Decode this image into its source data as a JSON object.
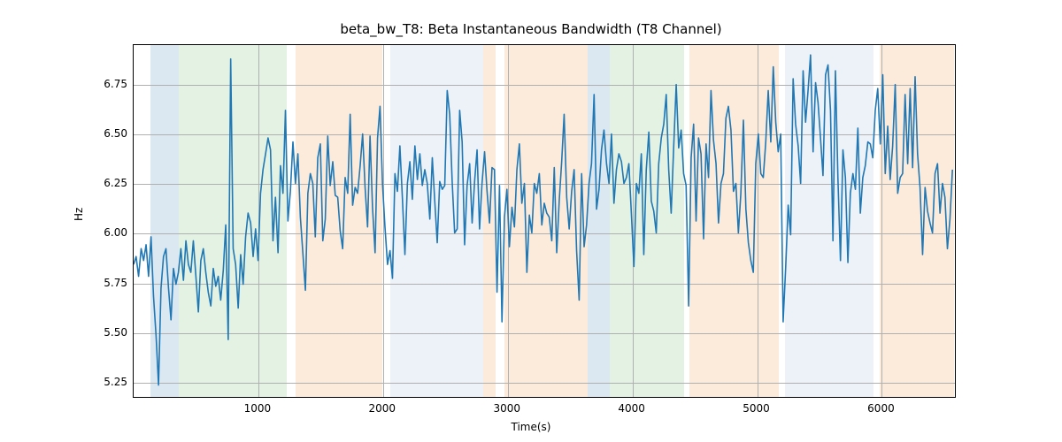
{
  "chart_data": {
    "type": "line",
    "title": "beta_bw_T8: Beta Instantaneous Bandwidth (T8 Channel)",
    "xlabel": "Time(s)",
    "ylabel": "Hz",
    "xlim": [
      0,
      6600
    ],
    "ylim": [
      5.17,
      6.95
    ],
    "x_ticks": [
      1000,
      2000,
      3000,
      4000,
      5000,
      6000
    ],
    "y_ticks": [
      5.25,
      5.5,
      5.75,
      6.0,
      6.25,
      6.5,
      6.75
    ],
    "x_tick_labels": [
      "1000",
      "2000",
      "3000",
      "4000",
      "5000",
      "6000"
    ],
    "y_tick_labels": [
      "5.25",
      "5.50",
      "5.75",
      "6.00",
      "6.25",
      "6.50",
      "6.75"
    ],
    "shaded_regions": [
      {
        "start": 135,
        "end": 365,
        "color": "blue"
      },
      {
        "start": 365,
        "end": 1230,
        "color": "green"
      },
      {
        "start": 1300,
        "end": 1995,
        "color": "orange"
      },
      {
        "start": 2060,
        "end": 2800,
        "color": "lblue"
      },
      {
        "start": 2800,
        "end": 2900,
        "color": "orange"
      },
      {
        "start": 2970,
        "end": 3640,
        "color": "orange"
      },
      {
        "start": 3640,
        "end": 3815,
        "color": "blue"
      },
      {
        "start": 3815,
        "end": 4415,
        "color": "green"
      },
      {
        "start": 4460,
        "end": 5175,
        "color": "orange"
      },
      {
        "start": 5225,
        "end": 5935,
        "color": "lblue"
      },
      {
        "start": 5980,
        "end": 6580,
        "color": "orange"
      }
    ],
    "values_sample_step": 20,
    "values": [
      5.84,
      5.88,
      5.78,
      5.92,
      5.86,
      5.94,
      5.78,
      5.98,
      5.68,
      5.48,
      5.23,
      5.72,
      5.88,
      5.92,
      5.72,
      5.56,
      5.82,
      5.74,
      5.8,
      5.92,
      5.76,
      5.96,
      5.84,
      5.8,
      5.96,
      5.78,
      5.6,
      5.86,
      5.92,
      5.8,
      5.7,
      5.63,
      5.82,
      5.73,
      5.78,
      5.66,
      5.81,
      6.04,
      5.46,
      6.88,
      5.92,
      5.84,
      5.62,
      5.89,
      5.74,
      5.98,
      6.1,
      6.05,
      5.88,
      6.02,
      5.86,
      6.2,
      6.32,
      6.4,
      6.48,
      6.42,
      5.96,
      6.18,
      5.9,
      6.34,
      6.2,
      6.62,
      6.06,
      6.21,
      6.46,
      6.25,
      6.4,
      6.08,
      5.9,
      5.71,
      6.2,
      6.3,
      6.25,
      5.98,
      6.38,
      6.45,
      5.96,
      6.07,
      6.49,
      6.24,
      6.36,
      6.19,
      6.18,
      6.01,
      5.92,
      6.28,
      6.2,
      6.6,
      6.14,
      6.23,
      6.2,
      6.34,
      6.5,
      6.23,
      6.03,
      6.49,
      6.13,
      5.9,
      6.48,
      6.64,
      6.25,
      6.03,
      5.84,
      5.91,
      5.77,
      6.3,
      6.21,
      6.44,
      6.17,
      5.89,
      6.25,
      6.36,
      6.17,
      6.44,
      6.27,
      6.4,
      6.24,
      6.32,
      6.25,
      6.07,
      6.38,
      6.16,
      5.95,
      6.26,
      6.22,
      6.24,
      6.72,
      6.6,
      6.26,
      6.0,
      6.02,
      6.62,
      6.46,
      5.94,
      6.24,
      6.35,
      6.05,
      6.26,
      6.42,
      6.02,
      6.25,
      6.41,
      6.21,
      6.05,
      6.33,
      6.32,
      5.7,
      6.24,
      5.55,
      6.08,
      6.22,
      5.93,
      6.13,
      6.03,
      6.32,
      6.45,
      6.15,
      6.25,
      5.8,
      6.09,
      6.0,
      6.25,
      6.2,
      6.3,
      6.04,
      6.15,
      6.1,
      6.08,
      5.96,
      6.33,
      5.9,
      6.16,
      6.36,
      6.6,
      6.18,
      6.02,
      6.21,
      6.32,
      5.91,
      5.66,
      6.3,
      5.93,
      6.04,
      6.25,
      6.35,
      6.7,
      6.12,
      6.22,
      6.42,
      6.52,
      6.35,
      6.25,
      6.5,
      6.15,
      6.32,
      6.4,
      6.36,
      6.25,
      6.28,
      6.35,
      6.1,
      5.83,
      6.25,
      6.2,
      6.4,
      5.89,
      6.32,
      6.51,
      6.16,
      6.11,
      6.0,
      6.35,
      6.48,
      6.55,
      6.7,
      6.32,
      6.1,
      6.43,
      6.75,
      6.43,
      6.52,
      6.3,
      6.24,
      5.63,
      6.38,
      6.55,
      6.06,
      6.48,
      6.4,
      5.97,
      6.45,
      6.28,
      6.72,
      6.47,
      6.35,
      6.05,
      6.25,
      6.3,
      6.58,
      6.64,
      6.52,
      6.21,
      6.25,
      6.0,
      6.2,
      6.57,
      6.12,
      5.95,
      5.86,
      5.8,
      6.35,
      6.5,
      6.3,
      6.28,
      6.46,
      6.72,
      6.46,
      6.84,
      6.56,
      6.41,
      6.5,
      5.55,
      5.83,
      6.14,
      5.99,
      6.78,
      6.55,
      6.44,
      6.25,
      6.82,
      6.56,
      6.72,
      6.9,
      6.41,
      6.76,
      6.66,
      6.48,
      6.29,
      6.8,
      6.85,
      6.62,
      5.96,
      6.82,
      6.28,
      5.86,
      6.42,
      6.28,
      5.85,
      6.2,
      6.3,
      6.22,
      6.53,
      6.1,
      6.28,
      6.34,
      6.46,
      6.45,
      6.38,
      6.62,
      6.73,
      6.45,
      6.8,
      6.3,
      6.54,
      6.27,
      6.44,
      6.75,
      6.2,
      6.28,
      6.3,
      6.7,
      6.35,
      6.73,
      6.33,
      6.79,
      6.4,
      6.23,
      5.89,
      6.23,
      6.11,
      6.05,
      6.0,
      6.3,
      6.35,
      6.1,
      6.25,
      6.18,
      5.92,
      6.07,
      6.32
    ]
  }
}
